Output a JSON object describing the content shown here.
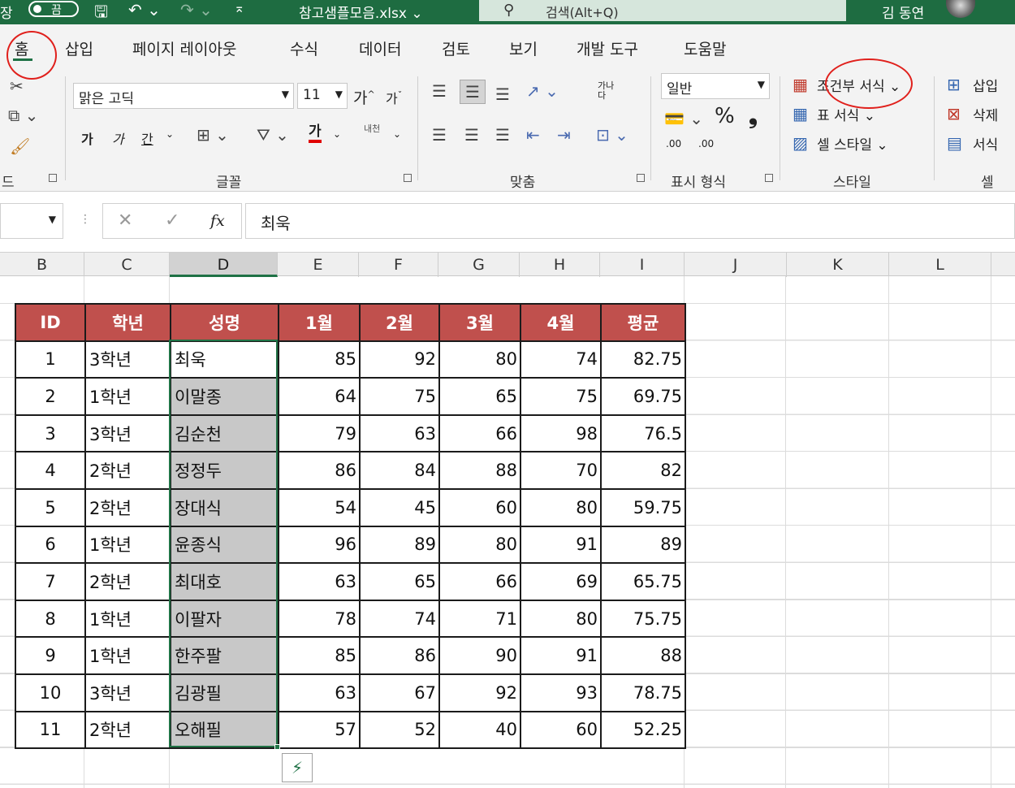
{
  "titlebar": {
    "autosave_label": "장",
    "toggle_text": "끔",
    "filename": "참고샘플모음.xlsx ⌄",
    "search_placeholder": "검색(Alt+Q)",
    "user_name": "김 동연"
  },
  "tabs": [
    {
      "label": "홈",
      "active": true
    },
    {
      "label": "삽입"
    },
    {
      "label": "페이지 레이아웃"
    },
    {
      "label": "수식"
    },
    {
      "label": "데이터"
    },
    {
      "label": "검토"
    },
    {
      "label": "보기"
    },
    {
      "label": "개발 도구"
    },
    {
      "label": "도움말"
    }
  ],
  "ribbon": {
    "clipboard_label": "드",
    "font": {
      "family": "맑은 고딕",
      "size": "11",
      "grow": "가",
      "shrink": "가",
      "bold": "가",
      "italic": "가",
      "underline": "간",
      "font_color_glyph": "가",
      "phonetic": "내천",
      "group_label": "글꼴"
    },
    "alignment": {
      "wrap_glyph": "가나\n다",
      "group_label": "맞춤"
    },
    "number": {
      "format": "일반",
      "percent": "%",
      "comma": "❟",
      "inc_decimal": ".00",
      "dec_decimal": ".00",
      "group_label": "표시 형식"
    },
    "styles": {
      "conditional": "조건부 서식",
      "table_format": "표 서식",
      "cell_styles": "셀 스타일",
      "group_label": "스타일"
    },
    "cells": {
      "insert": "삽입",
      "delete": "삭제",
      "format": "서식",
      "group_label": "셀"
    }
  },
  "formula_bar": {
    "fx": "fx",
    "content": "최욱"
  },
  "columns": [
    "B",
    "C",
    "D",
    "E",
    "F",
    "G",
    "H",
    "I",
    "J",
    "K",
    "L"
  ],
  "table": {
    "headers": [
      "ID",
      "학년",
      "성명",
      "1월",
      "2월",
      "3월",
      "4월",
      "평균"
    ],
    "rows": [
      [
        "1",
        "3학년",
        "최욱",
        "85",
        "92",
        "80",
        "74",
        "82.75"
      ],
      [
        "2",
        "1학년",
        "이말종",
        "64",
        "75",
        "65",
        "75",
        "69.75"
      ],
      [
        "3",
        "3학년",
        "김순천",
        "79",
        "63",
        "66",
        "98",
        "76.5"
      ],
      [
        "4",
        "2학년",
        "정정두",
        "86",
        "84",
        "88",
        "70",
        "82"
      ],
      [
        "5",
        "2학년",
        "장대식",
        "54",
        "45",
        "60",
        "80",
        "59.75"
      ],
      [
        "6",
        "1학년",
        "윤종식",
        "96",
        "89",
        "80",
        "91",
        "89"
      ],
      [
        "7",
        "2학년",
        "최대호",
        "63",
        "65",
        "66",
        "69",
        "65.75"
      ],
      [
        "8",
        "1학년",
        "이팔자",
        "78",
        "74",
        "71",
        "80",
        "75.75"
      ],
      [
        "9",
        "1학년",
        "한주팔",
        "85",
        "86",
        "90",
        "91",
        "88"
      ],
      [
        "10",
        "3학년",
        "김광필",
        "63",
        "67",
        "92",
        "93",
        "78.75"
      ],
      [
        "11",
        "2학년",
        "오해필",
        "57",
        "52",
        "40",
        "60",
        "52.25"
      ]
    ]
  },
  "colors": {
    "excel_green": "#1e6c41",
    "header_fill": "#c0504d",
    "selection_fill": "#c8c8c8",
    "annotation": "#e0201c"
  }
}
